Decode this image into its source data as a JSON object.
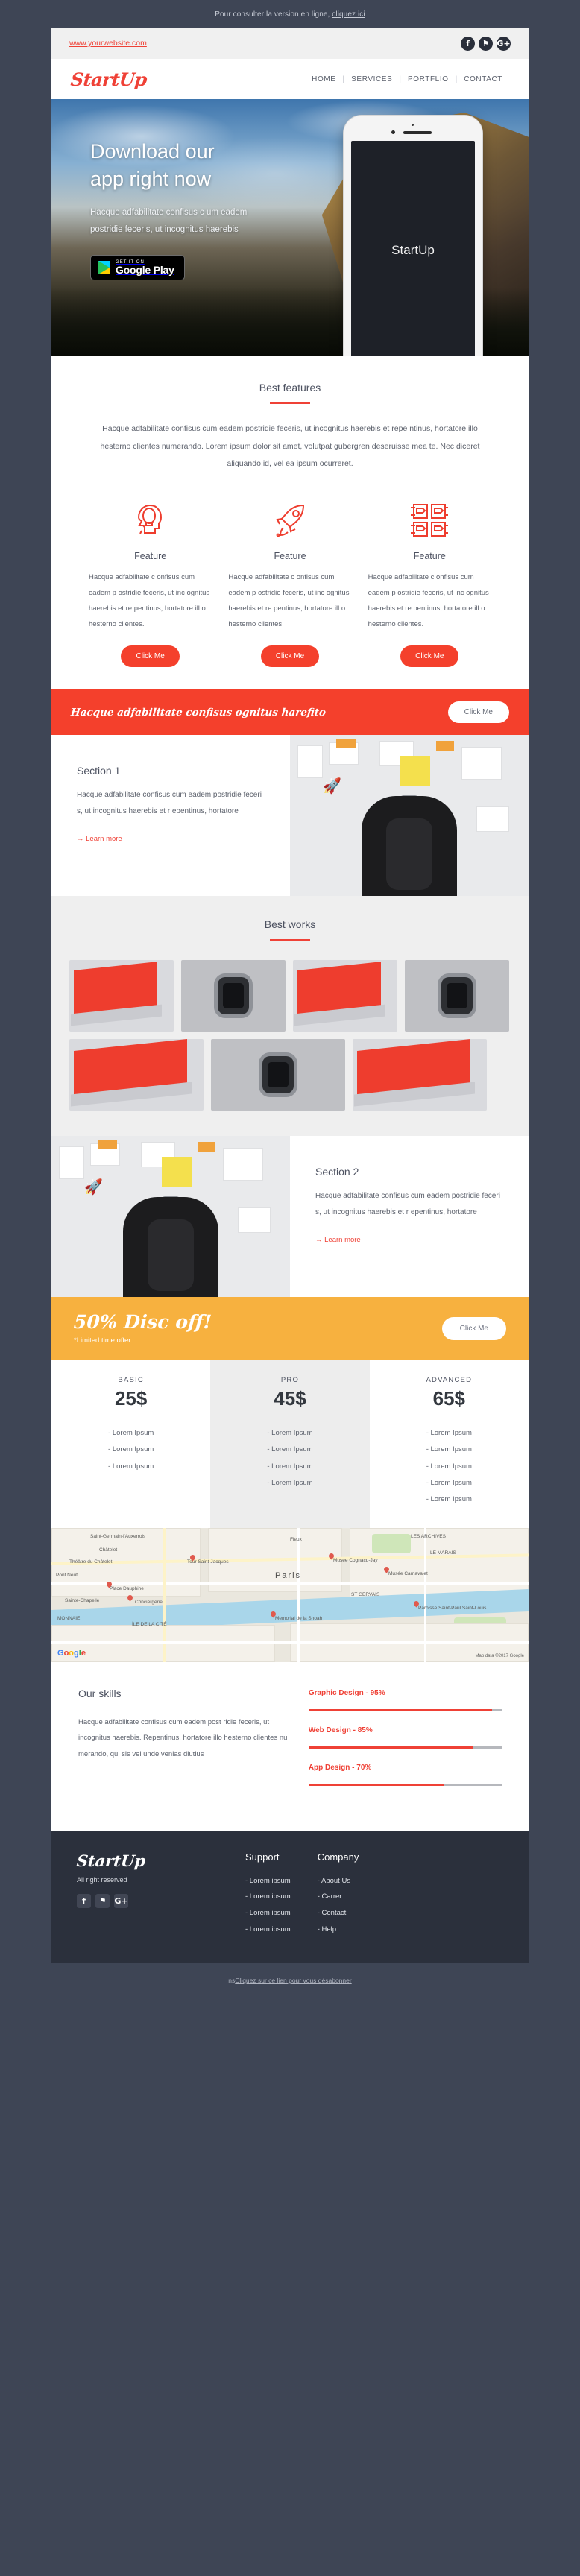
{
  "preheader": {
    "text": "Pour consulter la version en ligne, ",
    "link": "cliquez ici"
  },
  "topbar": {
    "website": "www.yourwebsite.com",
    "social": [
      {
        "name": "facebook",
        "glyph": "f"
      },
      {
        "name": "twitter",
        "glyph": "⚑"
      },
      {
        "name": "google-plus",
        "glyph": "G+"
      }
    ]
  },
  "nav": {
    "logo": "StartUp",
    "items": [
      "HOME",
      "SERVICES",
      "PORTFLIO",
      "CONTACT"
    ],
    "separator": "|"
  },
  "hero": {
    "title_line1": "Download our",
    "title_line2": "app right now",
    "paragraph": "Hacque adfabilitate confisus c um eadem postridie feceris, ut incognitus haerebis",
    "store_badge_small": "GET IT ON",
    "store_badge_big": "Google Play",
    "phone_screen_text": "StartUp"
  },
  "features_section": {
    "title": "Best features",
    "lead": "Hacque adfabilitate confisus cum eadem postridie feceris, ut incognitus haerebis et repe ntinus, hortatore illo hesterno clientes numerando. Lorem ipsum dolor sit amet, volutpat gubergren deseruisse mea te. Nec diceret aliquando id, vel ea ipsum ocurreret.",
    "items": [
      {
        "icon": "head-lightbulb-icon",
        "title": "Feature",
        "body": "Hacque adfabilitate c onfisus cum eadem p ostridie feceris, ut inc ognitus haerebis et re pentinus, hortatore ill o hesterno clientes.",
        "button": "Click Me"
      },
      {
        "icon": "rocket-icon",
        "title": "Feature",
        "body": "Hacque adfabilitate c onfisus cum eadem p ostridie feceris, ut inc ognitus haerebis et re pentinus, hortatore ill o hesterno clientes.",
        "button": "Click Me"
      },
      {
        "icon": "teamwork-handshake-icon",
        "title": "Feature",
        "body": "Hacque adfabilitate c onfisus cum eadem p ostridie feceris, ut inc ognitus haerebis et re pentinus, hortatore ill o hesterno clientes.",
        "button": "Click Me"
      }
    ]
  },
  "cta_band": {
    "text": "Hacque adfabilitate confisus ognitus harefito",
    "button": "Click Me"
  },
  "section1": {
    "title": "Section 1",
    "body": "Hacque adfabilitate confisus cum eadem postridie feceri s, ut incognitus haerebis et r epentinus, hortatore",
    "link": "→ Learn more"
  },
  "works_section": {
    "title": "Best works",
    "tiles": [
      {
        "name": "work-thumb-laptop-1",
        "kind": "laptop"
      },
      {
        "name": "work-thumb-watch-1",
        "kind": "watch"
      },
      {
        "name": "work-thumb-laptop-2",
        "kind": "laptop"
      },
      {
        "name": "work-thumb-watch-2",
        "kind": "watch"
      },
      {
        "name": "work-thumb-laptop-3",
        "kind": "laptop"
      },
      {
        "name": "work-thumb-watch-3",
        "kind": "watch"
      },
      {
        "name": "work-thumb-laptop-4",
        "kind": "laptop"
      }
    ]
  },
  "section2": {
    "title": "Section 2",
    "body": "Hacque adfabilitate confisus cum eadem postridie feceri s, ut incognitus haerebis et r epentinus, hortatore",
    "link": "→ Learn more"
  },
  "discount_band": {
    "headline": "50% Disc off!",
    "subline": "*Limited time offer",
    "button": "Click Me"
  },
  "pricing": {
    "plans": [
      {
        "name": "BASIC",
        "price": "25$",
        "highlight": false,
        "items": [
          "- Lorem Ipsum",
          "- Lorem Ipsum",
          "- Lorem Ipsum"
        ]
      },
      {
        "name": "PRO",
        "price": "45$",
        "highlight": true,
        "items": [
          "- Lorem Ipsum",
          "- Lorem Ipsum",
          "- Lorem Ipsum",
          "- Lorem Ipsum"
        ]
      },
      {
        "name": "ADVANCED",
        "price": "65$",
        "highlight": false,
        "items": [
          "- Lorem Ipsum",
          "- Lorem Ipsum",
          "- Lorem Ipsum",
          "- Lorem Ipsum",
          "- Lorem Ipsum"
        ]
      }
    ]
  },
  "map": {
    "city_label": "Paris",
    "labels": [
      "Saint-Germain-l'Auxerrois",
      "Châtelet",
      "Fleux",
      "LES ARCHIVES",
      "Théâtre du Châtelet",
      "Tour Saint-Jacques",
      "Musée Cognacq-Jay",
      "LE MARAIS",
      "Pont Neuf",
      "Place Dauphine",
      "Musée Carnavalet",
      "Sainte-Chapelle",
      "Conciergerie",
      "ST GERVAIS",
      "MONNAIE",
      "ÍLE DE LA CITÉ",
      "Memorial de la Shoah",
      "Paroisse Saint-Paul Saint-Louis"
    ],
    "watermark": "Google",
    "attribution": "Map data ©2017 Google"
  },
  "skills": {
    "title": "Our skills",
    "body": "Hacque adfabilitate confisus cum eadem post ridie feceris, ut incognitus haerebis. Repentinus, hortatore illo hesterno clientes nu merando, qui sis vel unde venias diutius",
    "bars": [
      {
        "label": "Graphic Design - 95%",
        "value": 95
      },
      {
        "label": "Web Design - 85%",
        "value": 85
      },
      {
        "label": "App Design - 70%",
        "value": 70
      }
    ]
  },
  "footer": {
    "logo": "StartUp",
    "rights": "All right reserved",
    "social": [
      {
        "name": "facebook",
        "glyph": "f"
      },
      {
        "name": "twitter",
        "glyph": "⚑"
      },
      {
        "name": "google-plus",
        "glyph": "G+"
      }
    ],
    "columns": [
      {
        "heading": "Support",
        "links": [
          "- Lorem ipsum",
          "- Lorem ipsum",
          "- Lorem ipsum",
          "- Lorem ipsum"
        ]
      },
      {
        "heading": "Company",
        "links": [
          "- About Us",
          "- Carrer",
          "- Contact",
          "- Help"
        ]
      }
    ]
  },
  "unsubscribe": {
    "prefix": "ns",
    "link": "Cliquez sur ce lien pour vous désabonner"
  },
  "colors": {
    "brand_red": "#ef4136",
    "button_red": "#f4402c",
    "amber": "#f7b13f",
    "dark": "#2b303c",
    "page_bg": "#3e4555"
  }
}
